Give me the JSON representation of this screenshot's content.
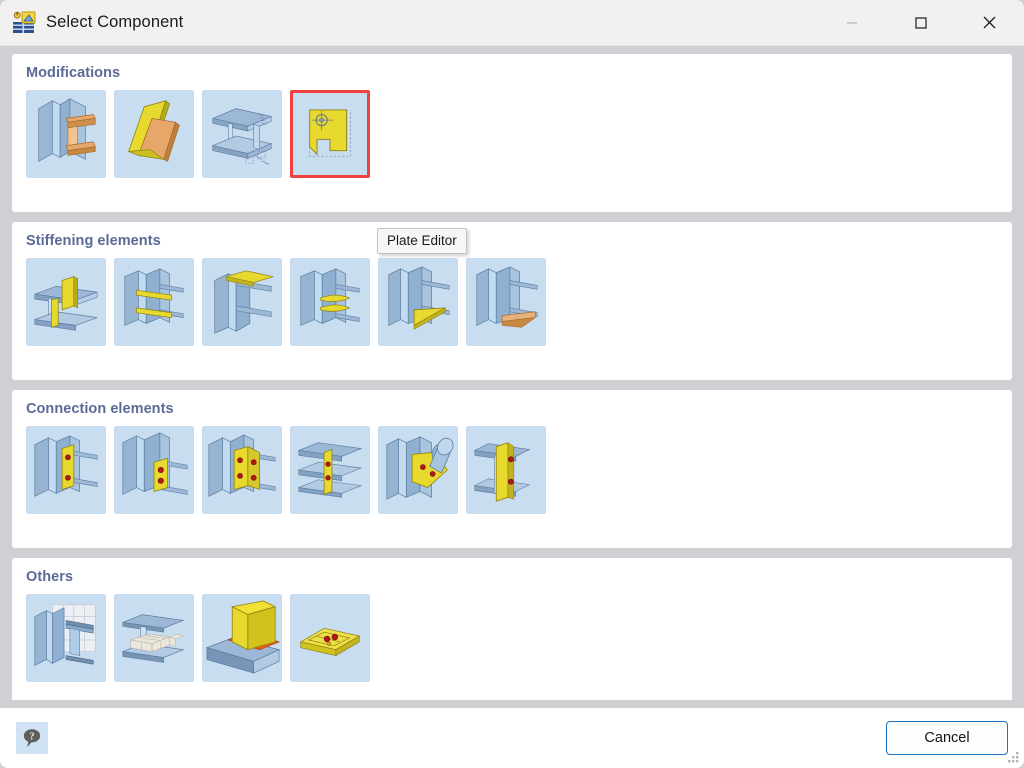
{
  "window": {
    "title": "Select Component",
    "app_icon": "steel-component-icon",
    "controls": {
      "minimize": {
        "label": "Minimize",
        "icon": "minimize-icon",
        "disabled": true
      },
      "maximize": {
        "label": "Maximize",
        "icon": "maximize-icon",
        "disabled": false
      },
      "close": {
        "label": "Close",
        "icon": "close-icon",
        "disabled": false
      }
    }
  },
  "tooltip": {
    "visible": true,
    "text": "Plate Editor"
  },
  "groups": [
    {
      "id": "modifications",
      "title": "Modifications",
      "items": [
        {
          "id": "end-plate-cut",
          "icon": "beam-end-plate-icon",
          "selected": false
        },
        {
          "id": "plate-folding",
          "icon": "folded-plate-icon",
          "selected": false
        },
        {
          "id": "beam-cut-notch",
          "icon": "beam-notch-cut-icon",
          "selected": false
        },
        {
          "id": "plate-editor",
          "icon": "plate-editor-icon",
          "selected": true
        }
      ]
    },
    {
      "id": "stiffening-elements",
      "title": "Stiffening elements",
      "items": [
        {
          "id": "vertical-stiffener",
          "icon": "vertical-stiffener-icon",
          "selected": false
        },
        {
          "id": "horizontal-stiffeners",
          "icon": "horizontal-stiffener-icon",
          "selected": false
        },
        {
          "id": "top-flange-plate",
          "icon": "top-flange-plate-icon",
          "selected": false
        },
        {
          "id": "curved-stiffeners",
          "icon": "curved-stiffener-icon",
          "selected": false
        },
        {
          "id": "haunch-plate",
          "icon": "haunch-plate-icon",
          "selected": false
        },
        {
          "id": "bottom-haunch",
          "icon": "bottom-haunch-icon",
          "selected": false
        }
      ]
    },
    {
      "id": "connection-elements",
      "title": "Connection elements",
      "items": [
        {
          "id": "end-plate-bolted",
          "icon": "end-plate-bolted-icon",
          "selected": false
        },
        {
          "id": "fin-plate",
          "icon": "fin-plate-icon",
          "selected": false
        },
        {
          "id": "double-fin-plate",
          "icon": "double-fin-plate-icon",
          "selected": false
        },
        {
          "id": "web-cleat",
          "icon": "web-cleat-icon",
          "selected": false
        },
        {
          "id": "tube-gusset",
          "icon": "tube-gusset-icon",
          "selected": false
        },
        {
          "id": "column-splice",
          "icon": "column-splice-icon",
          "selected": false
        }
      ]
    },
    {
      "id": "others",
      "title": "Others",
      "items": [
        {
          "id": "surface-mesh",
          "icon": "mesh-surface-icon",
          "selected": false
        },
        {
          "id": "solid-mesh",
          "icon": "solid-mesh-icon",
          "selected": false
        },
        {
          "id": "weld-seam",
          "icon": "weld-seam-icon",
          "selected": false
        },
        {
          "id": "bolt-grid",
          "icon": "bolt-grid-icon",
          "selected": false
        }
      ]
    }
  ],
  "footer": {
    "help": {
      "label": "Help",
      "icon": "help-balloon-icon"
    },
    "cancel_label": "Cancel",
    "resize_grip": "resize-grip-icon"
  },
  "colors": {
    "accent_blue": "#1b74c4",
    "group_title": "#5b6a96",
    "tile_background": "#c9ddf1",
    "selection_red": "#f04040",
    "window_background": "#d0d0d4",
    "panel_white": "#ffffff",
    "titlebar": "#f3f1f0"
  }
}
